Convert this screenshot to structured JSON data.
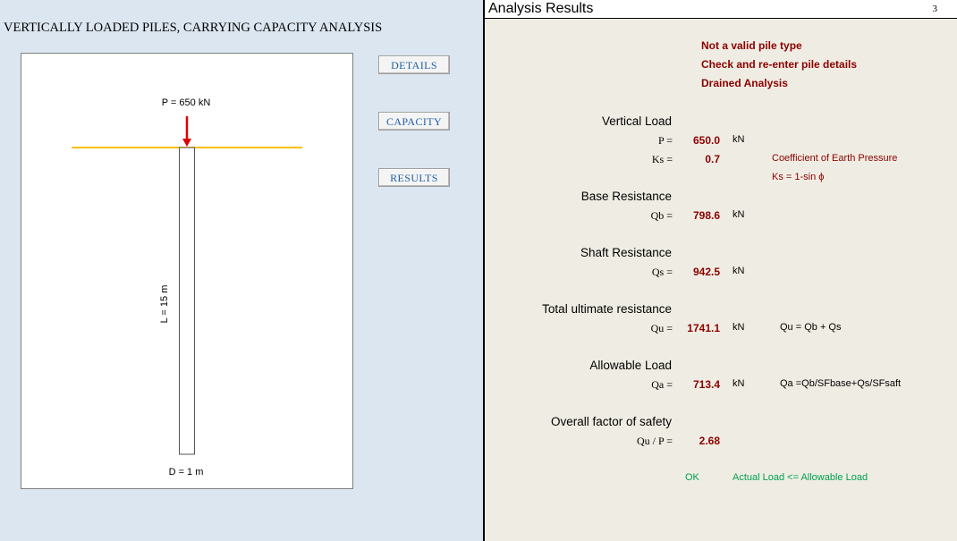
{
  "left": {
    "title": "VERTICALLY LOADED PILES, CARRYING CAPACITY ANALYSIS",
    "diagram": {
      "load_label": "P = 650 kN",
      "length_label": "L = 15 m",
      "diameter_label": "D = 1 m"
    },
    "buttons": {
      "details": "DETAILS",
      "capacity": "CAPACITY",
      "results": "RESULTS"
    }
  },
  "right": {
    "title": "Analysis Results",
    "page_number": "3",
    "messages": [
      "Not a valid pile type",
      "Check and re-enter pile details",
      "Drained Analysis"
    ],
    "vertical_load": {
      "heading": "Vertical Load",
      "p_label": "P =",
      "p_value": "650.0",
      "p_unit": "kN",
      "ks_label": "Ks =",
      "ks_value": "0.7",
      "ks_note": "Coefficient of Earth Pressure",
      "ks_formula": "Ks = 1-sin ϕ"
    },
    "base": {
      "heading": "Base Resistance",
      "label": "Qb =",
      "value": "798.6",
      "unit": "kN"
    },
    "shaft": {
      "heading": "Shaft Resistance",
      "label": "Qs =",
      "value": "942.5",
      "unit": "kN"
    },
    "total": {
      "heading": "Total ultimate resistance",
      "label": "Qu =",
      "value": "1741.1",
      "unit": "kN",
      "formula": "Qu = Qb + Qs"
    },
    "allowable": {
      "heading": "Allowable Load",
      "label": "Qa =",
      "value": "713.4",
      "unit": "kN",
      "formula": "Qa =Qb/SFbase+Qs/SFsaft"
    },
    "safety": {
      "heading": "Overall factor of safety",
      "label": "Qu / P =",
      "value": "2.68"
    },
    "status": {
      "ok": "OK",
      "note": "Actual Load <= Allowable Load"
    }
  },
  "colors": {
    "left_background": "#dce6f1",
    "right_background": "#efede3",
    "value_red": "#8b0000",
    "ok_green": "#00a050",
    "ground_line": "#ffc000",
    "load_arrow": "#e00000",
    "button_text": "#1f5fa8"
  }
}
